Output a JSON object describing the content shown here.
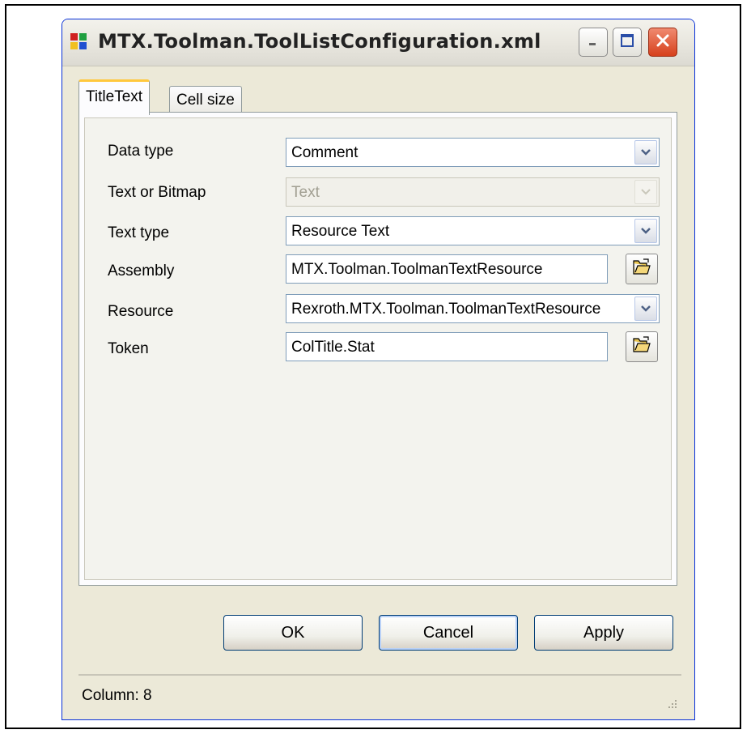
{
  "window": {
    "title": "MTX.Toolman.ToolListConfiguration.xml"
  },
  "tabs": [
    {
      "label": "TitleText",
      "active": true
    },
    {
      "label": "Cell size",
      "active": false
    }
  ],
  "form": {
    "data_type": {
      "label": "Data type",
      "value": "Comment"
    },
    "text_or_bitmap": {
      "label": "Text or Bitmap",
      "value": "Text"
    },
    "text_type": {
      "label": "Text type",
      "value": "Resource Text"
    },
    "assembly": {
      "label": "Assembly",
      "value": "MTX.Toolman.ToolmanTextResource"
    },
    "resource": {
      "label": "Resource",
      "value": "Rexroth.MTX.Toolman.ToolmanTextResource"
    },
    "token": {
      "label": "Token",
      "value": "ColTitle.Stat"
    }
  },
  "buttons": {
    "ok": "OK",
    "cancel": "Cancel",
    "apply": "Apply"
  },
  "status": {
    "text": "Column: 8"
  },
  "icons": {
    "app": "app-window-icon",
    "minimize": "minimize-icon",
    "maximize": "maximize-icon",
    "close": "close-icon",
    "dropdown": "chevron-down-icon",
    "browse": "open-folder-icon",
    "grip": "resize-grip-icon"
  },
  "colors": {
    "window_bg": "#ece9d8",
    "field_border": "#7f9db9",
    "tab_highlight": "#ffc83c",
    "close_button": "#d6401c"
  }
}
